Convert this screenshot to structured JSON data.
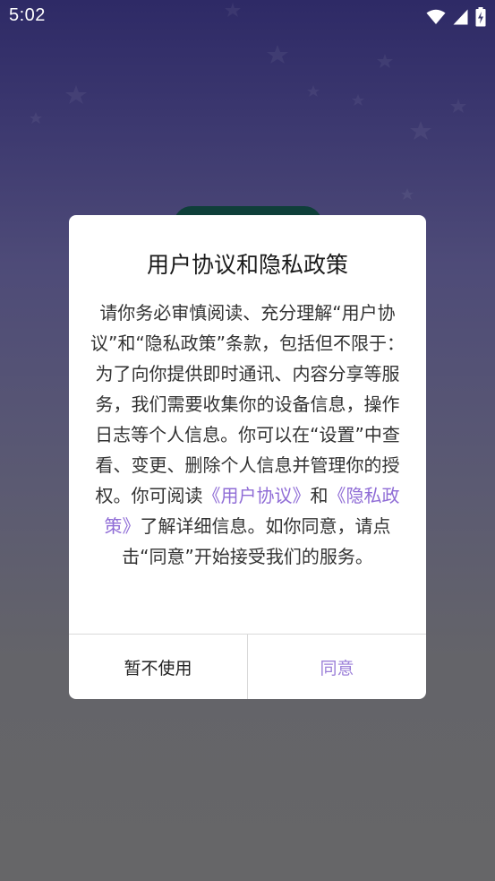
{
  "status_bar": {
    "time": "5:02",
    "icons": [
      "wifi-icon",
      "cell-signal-icon",
      "battery-charging-icon"
    ]
  },
  "dialog": {
    "title": "用户协议和隐私政策",
    "body_part1": "请你务必审慎阅读、充分理解“用户协议”和“隐私政策”条款，包括但不限于：为了向你提供即时通讯、内容分享等服务，我们需要收集你的设备信息，操作日志等个人信息。你可以在“设置”中查看、变更、删除个人信息并管理你的授权。你可阅读",
    "link_user_agreement": "《用户协议》",
    "body_and": "和",
    "link_privacy_policy": "《隐私政策》",
    "body_part2": "了解详细信息。如你同意，请点击“同意”开始接受我们的服务。",
    "decline_label": "暂不使用",
    "agree_label": "同意"
  },
  "colors": {
    "link": "#8f6cd6",
    "agree_text": "#9b7fd8",
    "background_top": "#2e2a66",
    "background_bottom": "#666668",
    "obscured_button": "#0f3f3a"
  }
}
